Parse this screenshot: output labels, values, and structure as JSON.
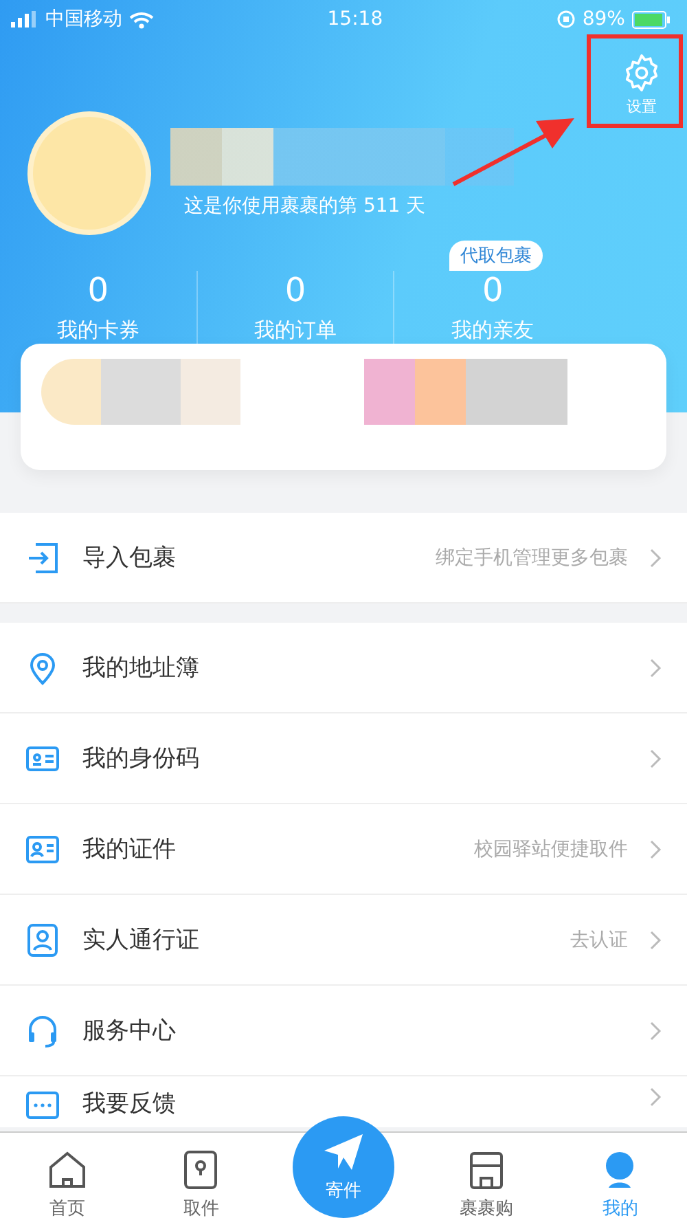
{
  "status_bar": {
    "carrier": "中国移动",
    "time": "15:18",
    "battery": "89%"
  },
  "header": {
    "settings_label": "设置",
    "days_text": "这是你使用裹裹的第 511 天",
    "badge": "代取包裹",
    "stats": [
      {
        "value": "0",
        "label": "我的卡券"
      },
      {
        "value": "0",
        "label": "我的订单"
      },
      {
        "value": "0",
        "label": "我的亲友"
      }
    ]
  },
  "import_row": {
    "label": "导入包裹",
    "hint": "绑定手机管理更多包裹"
  },
  "menu": [
    {
      "label": "我的地址簿"
    },
    {
      "label": "我的身份码"
    },
    {
      "label": "我的证件",
      "hint": "校园驿站便捷取件"
    },
    {
      "label": "实人通行证",
      "hint": "去认证"
    },
    {
      "label": "服务中心"
    },
    {
      "label": "我要反馈"
    }
  ],
  "tab_bar": [
    {
      "label": "首页",
      "kind": "tab",
      "selected": false
    },
    {
      "label": "取件",
      "kind": "tab",
      "selected": false
    },
    {
      "label": "寄件",
      "kind": "fab"
    },
    {
      "label": "裹裹购",
      "kind": "tab",
      "selected": false
    },
    {
      "label": "我的",
      "kind": "tab",
      "selected": true
    }
  ]
}
